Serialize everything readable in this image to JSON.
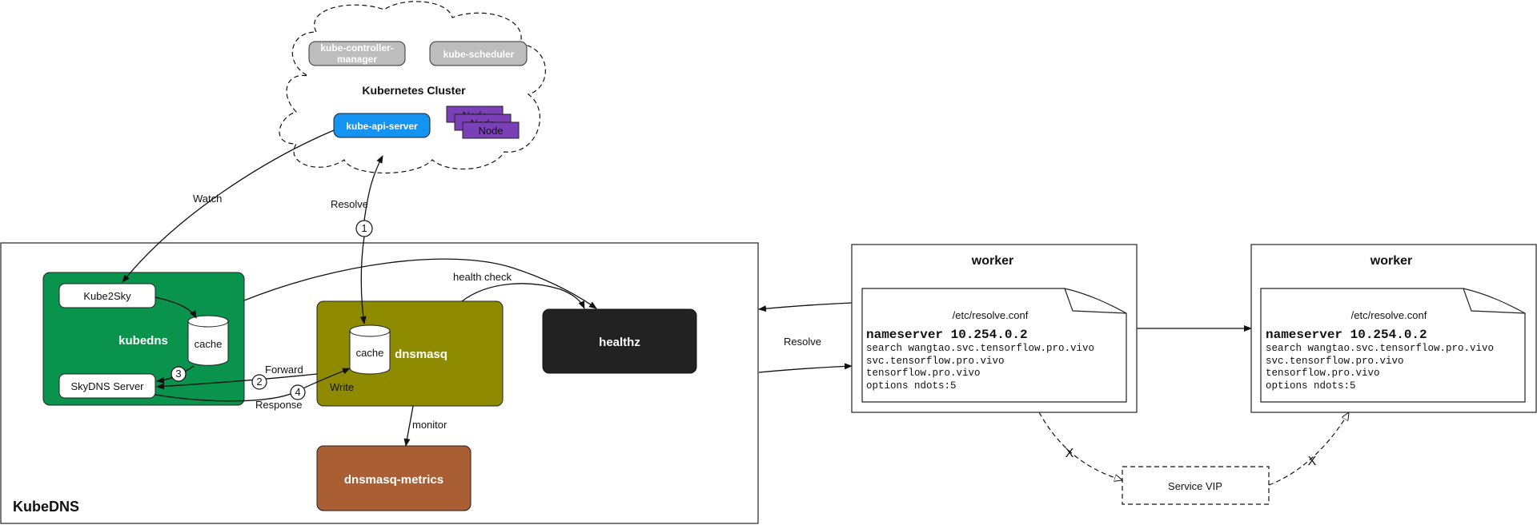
{
  "colors": {
    "kubedns": "#0a934d",
    "dnsmasq": "#8f8b00",
    "healthz": "#222222",
    "metrics": "#a95e33",
    "api_server": "#1593f0",
    "control_plane": "#bdbdbd",
    "node": "#7b3fb7"
  },
  "cluster": {
    "title": "Kubernetes Cluster",
    "controller_manager": [
      "kube-controller-",
      "manager"
    ],
    "scheduler": "kube-scheduler",
    "api_server": "kube-api-server",
    "nodes": [
      "Node",
      "Node",
      "Node"
    ]
  },
  "kubedns_box": {
    "title": "KubeDNS",
    "kubedns": {
      "label": "kubedns",
      "kube2sky": "Kube2Sky",
      "cache": "cache",
      "skydns": "SkyDNS Server"
    },
    "dnsmasq": {
      "label": "dnsmasq",
      "cache": "cache"
    },
    "healthz": "healthz",
    "metrics": "dnsmasq-metrics"
  },
  "edges": {
    "watch": "Watch",
    "resolve_up": "Resolve",
    "health_check": "health check",
    "forward": "Forward",
    "response": "Response",
    "write": "Write",
    "monitor": "monitor",
    "resolve_worker": "Resolve",
    "step1": "1",
    "step2": "2",
    "step3": "3",
    "step4": "4",
    "blocked1": "X",
    "blocked2": "X"
  },
  "workers": [
    {
      "title": "worker",
      "file": "/etc/resolve.conf",
      "nameserver": "nameserver 10.254.0.2",
      "lines": [
        "search wangtao.svc.tensorflow.pro.vivo",
        "svc.tensorflow.pro.vivo",
        "tensorflow.pro.vivo",
        "options ndots:5"
      ]
    },
    {
      "title": "worker",
      "file": "/etc/resolve.conf",
      "nameserver": "nameserver 10.254.0.2",
      "lines": [
        "search wangtao.svc.tensorflow.pro.vivo",
        "svc.tensorflow.pro.vivo",
        "tensorflow.pro.vivo",
        "options ndots:5"
      ]
    }
  ],
  "service_vip": "Service VIP"
}
